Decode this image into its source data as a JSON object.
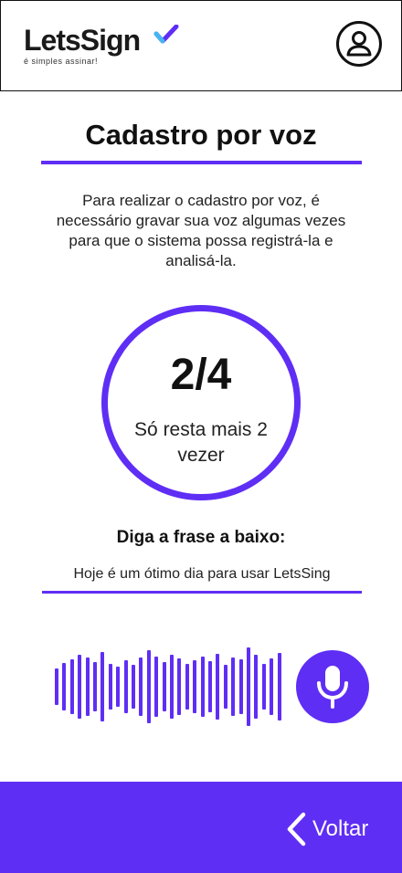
{
  "header": {
    "logo_text": "LetsSign",
    "logo_tagline": "é simples assinar!",
    "profile_icon": "user-circle-icon"
  },
  "main": {
    "title": "Cadastro por voz",
    "intro": "Para realizar o cadastro por voz, é necessário gravar sua voz algumas vezes para que o sistema possa registrá-la e analisá-la.",
    "progress": {
      "count": "2/4",
      "recorded": 2,
      "total": 4,
      "remaining_text": "Só resta mais 2 vezer"
    },
    "prompt_label": "Diga a frase a baixo:",
    "phrase": "Hoje é um ótimo dia para usar LetsSing",
    "waveform_icon": "audio-waveform-icon",
    "mic_icon": "microphone-icon"
  },
  "footer": {
    "back_label": "Voltar",
    "back_icon": "chevron-left-icon"
  },
  "colors": {
    "accent": "#5f2ef5",
    "text": "#111111",
    "background": "#ffffff"
  }
}
